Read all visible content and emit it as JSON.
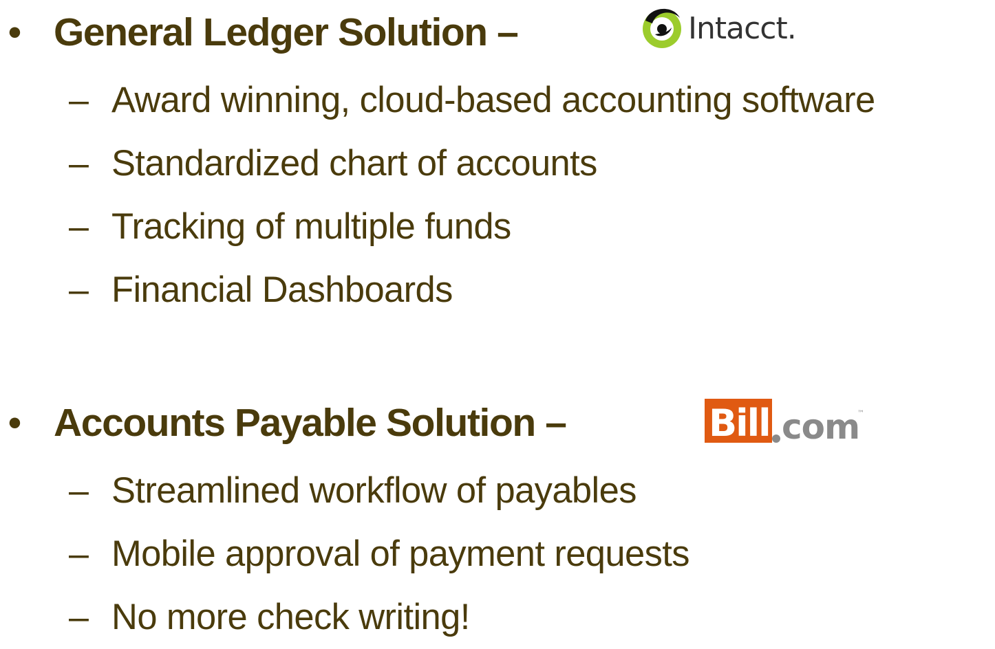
{
  "sections": [
    {
      "heading": "General Ledger Solution –",
      "logo_text": "Intacct.",
      "logo_icon": "intacct-swirl-logo",
      "items": [
        "Award winning, cloud-based accounting software",
        "Standardized chart of accounts",
        "Tracking of multiple funds",
        "Financial Dashboards"
      ]
    },
    {
      "heading": "Accounts Payable Solution –",
      "logo_text": "Bill.com",
      "logo_icon": "bill-com-logo",
      "items": [
        "Streamlined workflow of payables",
        "Mobile approval of payment requests",
        "No more check writing!"
      ]
    }
  ],
  "bullet_glyph": "•",
  "dash_glyph": "–",
  "colors": {
    "text": "#4a3b0c",
    "intacct_green": "#9ccc2c",
    "bill_orange": "#e05a12",
    "bill_gray": "#8a8a8a"
  }
}
